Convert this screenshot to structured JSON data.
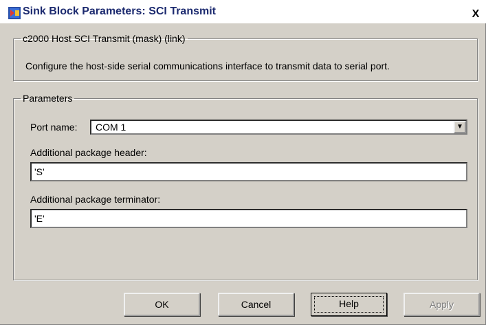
{
  "window": {
    "title": "Sink Block Parameters: SCI Transmit",
    "close_label": "X"
  },
  "mask_group": {
    "legend": "c2000 Host SCI Transmit (mask) (link)",
    "description": "Configure the host-side serial communications interface to transmit data to serial port."
  },
  "parameters": {
    "legend": "Parameters",
    "port_name": {
      "label": "Port name:",
      "value": "COM 1"
    },
    "header": {
      "label": "Additional package header:",
      "value": "'S'"
    },
    "terminator": {
      "label": "Additional package terminator:",
      "value": "'E'"
    }
  },
  "buttons": {
    "ok": "OK",
    "cancel": "Cancel",
    "help": "Help",
    "apply": "Apply"
  },
  "colors": {
    "background": "#d4d0c8",
    "title_text": "#1c2a6f",
    "disabled_text": "#808080"
  }
}
